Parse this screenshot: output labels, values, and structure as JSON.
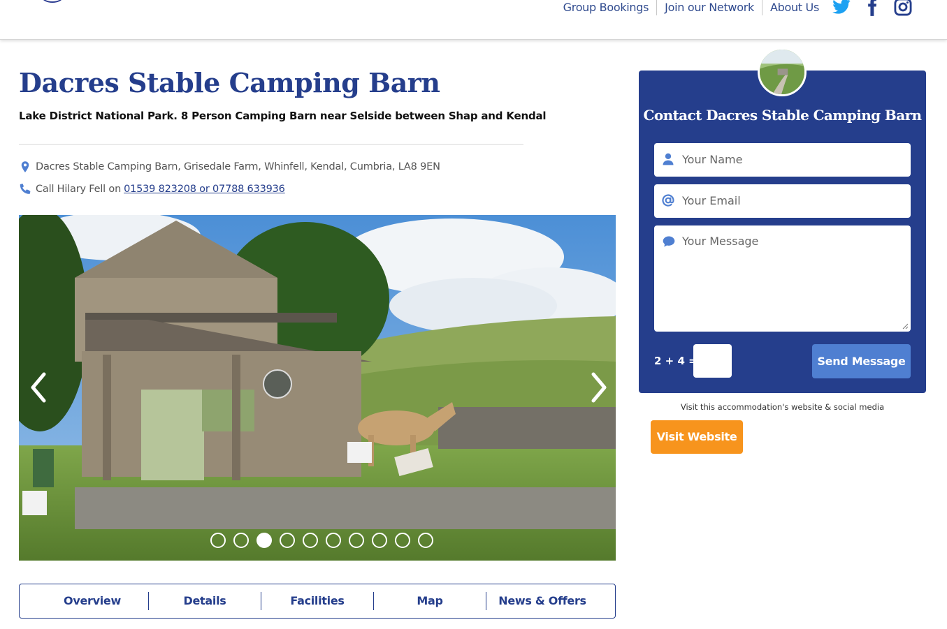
{
  "header": {
    "nav": [
      "Group Bookings",
      "Join our Network",
      "About Us"
    ],
    "social_icons": [
      "twitter-icon",
      "facebook-icon",
      "instagram-icon"
    ],
    "colors": {
      "nav_text": "#2f4a8e",
      "twitter": "#1da1f2",
      "facebook_instagram": "#253e8c"
    }
  },
  "listing": {
    "title": "Dacres Stable Camping Barn",
    "subtitle": "Lake District National Park. 8 Person Camping Barn near Selside between Shap and Kendal",
    "address": "Dacres Stable Camping Barn, Grisedale Farm, Whinfell, Kendal, Cumbria, LA8 9EN",
    "phone_prefix": "Call Hilary Fell on",
    "phone_numbers": "01539 823208 or 07788 633936",
    "colors": {
      "title": "#253e8c",
      "icons": "#4f7fd1"
    }
  },
  "gallery": {
    "slide_count": 10,
    "active_index": 2,
    "prev_icon": "chevron-left-icon",
    "next_icon": "chevron-right-icon"
  },
  "tabs": [
    "Overview",
    "Details",
    "Facilities",
    "Map",
    "News & Offers"
  ],
  "contact": {
    "title": "Contact Dacres Stable Camping Barn",
    "name_placeholder": "Your Name",
    "email_placeholder": "Your Email",
    "message_placeholder": "Your Message",
    "captcha_label": "2 + 4 =",
    "send_label": "Send Message",
    "colors": {
      "panel": "#253e8c",
      "send_button": "#4f7fd1"
    }
  },
  "visit": {
    "note": "Visit this accommodation's website & social media",
    "button_label": "Visit Website",
    "color": "#f7941d"
  }
}
